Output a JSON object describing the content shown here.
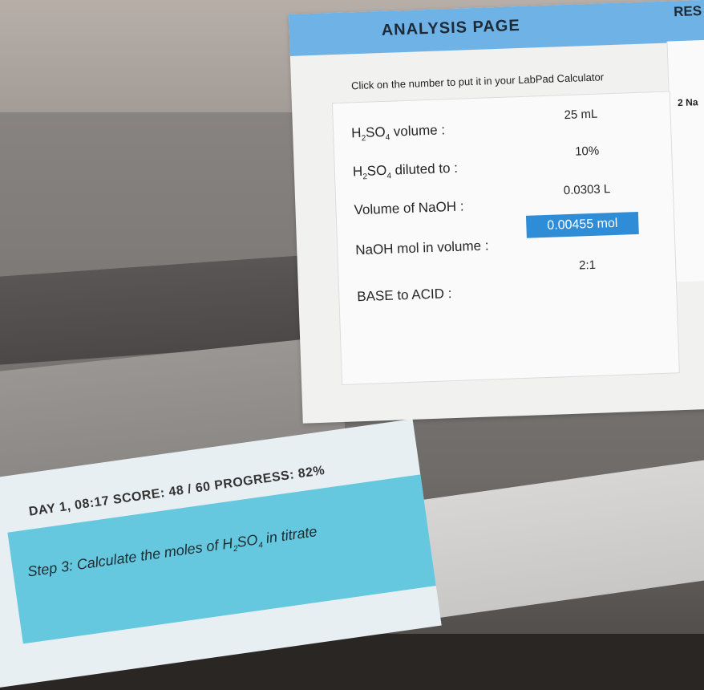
{
  "analysis": {
    "title": "ANALYSIS PAGE",
    "next_title": "RES",
    "instruction": "Click on the number to put it in your LabPad Calculator",
    "rows": [
      {
        "label_prefix": "H",
        "label_sub1": "2",
        "label_mid": "SO",
        "label_sub2": "4",
        "label_suffix": " volume :",
        "value": "25 mL"
      },
      {
        "label_prefix": "H",
        "label_sub1": "2",
        "label_mid": "SO",
        "label_sub2": "4",
        "label_suffix": " diluted to :",
        "value": "10%"
      },
      {
        "label": "Volume of NaOH :",
        "value": "0.0303 L"
      },
      {
        "label": "NaOH mol in volume :",
        "value": "0.00455 mol"
      },
      {
        "label": "BASE to ACID :",
        "value": "2:1"
      }
    ],
    "side_text": "2 Na"
  },
  "status": {
    "line": "DAY 1, 08:17   SCORE: 48 / 60   PROGRESS: 82%",
    "step_prefix": "Step 3: Calculate the moles of H",
    "step_sub1": "2",
    "step_mid": "SO",
    "step_sub2": "4",
    "step_suffix": " in titrate"
  },
  "colors": {
    "header": "#6fb3e6",
    "highlight": "#2f8dd8",
    "step_box": "#66c8df"
  }
}
